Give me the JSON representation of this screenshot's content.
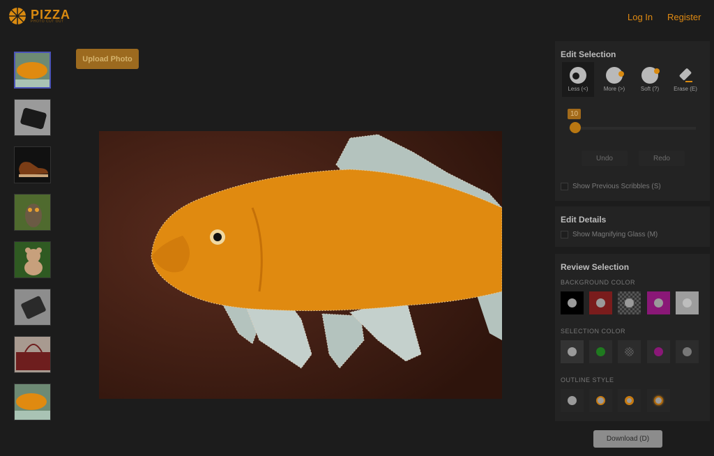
{
  "brand": {
    "name": "PIZZA",
    "tagline": "PHOTO CUT OUT"
  },
  "nav": {
    "login": "Log In",
    "register": "Register"
  },
  "thumbnails": [
    {
      "name": "goldfish",
      "selected": true
    },
    {
      "name": "black-wallet",
      "selected": false
    },
    {
      "name": "brown-shoe",
      "selected": false
    },
    {
      "name": "owl",
      "selected": false
    },
    {
      "name": "teddy-bear",
      "selected": false
    },
    {
      "name": "gray-wallet",
      "selected": false
    },
    {
      "name": "brown-bag",
      "selected": false
    },
    {
      "name": "goldfish-2",
      "selected": false
    }
  ],
  "upload_label": "Upload Photo",
  "edit_selection": {
    "title": "Edit Selection",
    "tools": [
      {
        "label": "Less (<)",
        "icon": "less-brush-icon",
        "selected": true
      },
      {
        "label": "More (>)",
        "icon": "more-brush-icon",
        "selected": false
      },
      {
        "label": "Soft (?)",
        "icon": "soft-brush-icon",
        "selected": false
      },
      {
        "label": "Erase (E)",
        "icon": "eraser-icon",
        "selected": false
      }
    ],
    "brush_size": "10",
    "undo": "Undo",
    "redo": "Redo",
    "show_scribbles": "Show Previous Scribbles (S)"
  },
  "edit_details": {
    "title": "Edit Details",
    "magnifier": "Show Magnifying Glass (M)"
  },
  "review_selection": {
    "title": "Review Selection",
    "background_label": "BACKGROUND COLOR",
    "background_colors": [
      "#000000",
      "#8b2020",
      "checker",
      "#a01a8a",
      "#cfcfcf"
    ],
    "selection_label": "SELECTION COLOR",
    "selection_colors": [
      "#ffffff",
      "#1f8a1f",
      "checker",
      "#a01a8a",
      "#8a8a8a"
    ],
    "outline_label": "OUTLINE STYLE"
  },
  "download_label": "Download (D)",
  "accent": "#d98a10"
}
